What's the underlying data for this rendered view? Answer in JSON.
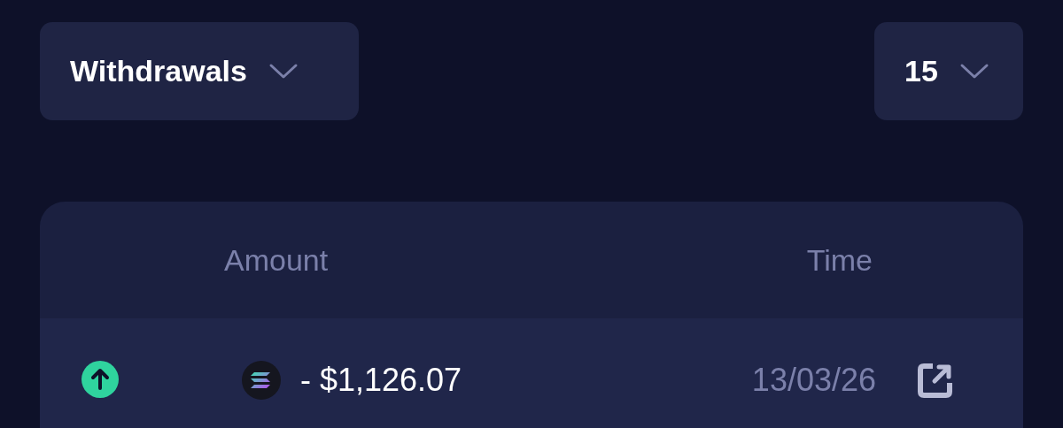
{
  "filters": {
    "type": "Withdrawals",
    "page_size": "15"
  },
  "table": {
    "columns": [
      "Amount",
      "Time"
    ],
    "rows": [
      {
        "amount": "- $1,126.07",
        "time": "13/03/26"
      }
    ]
  }
}
